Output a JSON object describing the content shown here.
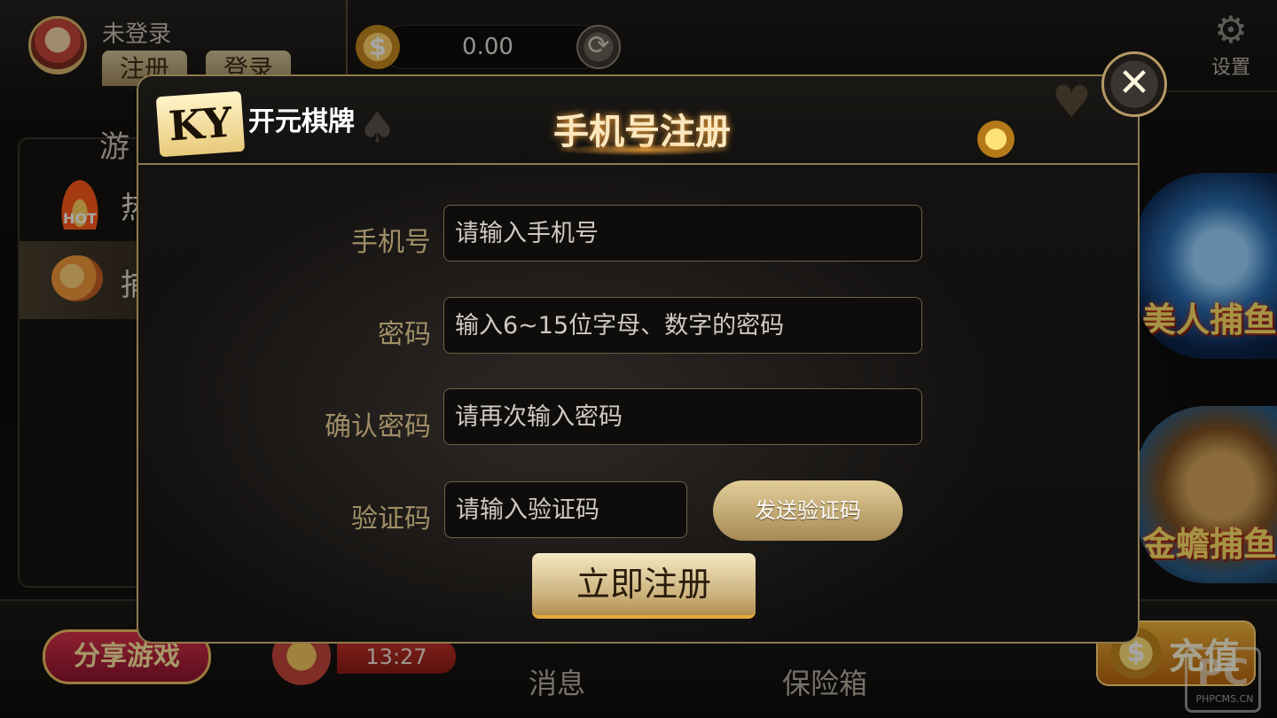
{
  "topbar": {
    "username": "未登录",
    "register_label": "注册",
    "login_label": "登录",
    "balance": "0.00",
    "coin_symbol": "$",
    "settings_label": "设置"
  },
  "sidebar": {
    "title": "游",
    "items": [
      {
        "label": "热",
        "badge": "HOT",
        "icon": "hot-flame-icon"
      },
      {
        "label": "捕",
        "icon": "fish-icon"
      }
    ]
  },
  "games": [
    {
      "title": "美人捕鱼"
    },
    {
      "title": "金蟾捕鱼"
    }
  ],
  "bottombar": {
    "share_label": "分享游戏",
    "timer": "13:27",
    "messages_label": "消息",
    "safe_label": "保险箱",
    "recharge_label": "充值",
    "recharge_symbol": "$",
    "watermark": "PC",
    "watermark_url": "PHPCMS.CN"
  },
  "modal": {
    "logo_letters": "KY",
    "logo_text": "开元棋牌",
    "title": "手机号注册",
    "close_symbol": "✕",
    "fields": {
      "phone": {
        "label": "手机号",
        "placeholder": "请输入手机号"
      },
      "password": {
        "label": "密码",
        "placeholder": "输入6~15位字母、数字的密码"
      },
      "confirm": {
        "label": "确认密码",
        "placeholder": "请再次输入密码"
      },
      "code": {
        "label": "验证码",
        "placeholder": "请输入验证码"
      }
    },
    "send_code_label": "发送验证码",
    "submit_label": "立即注册"
  },
  "colors": {
    "gold": "#a08e66",
    "border_gold": "#8f7a4e",
    "button_gold": "#cbb07a"
  }
}
